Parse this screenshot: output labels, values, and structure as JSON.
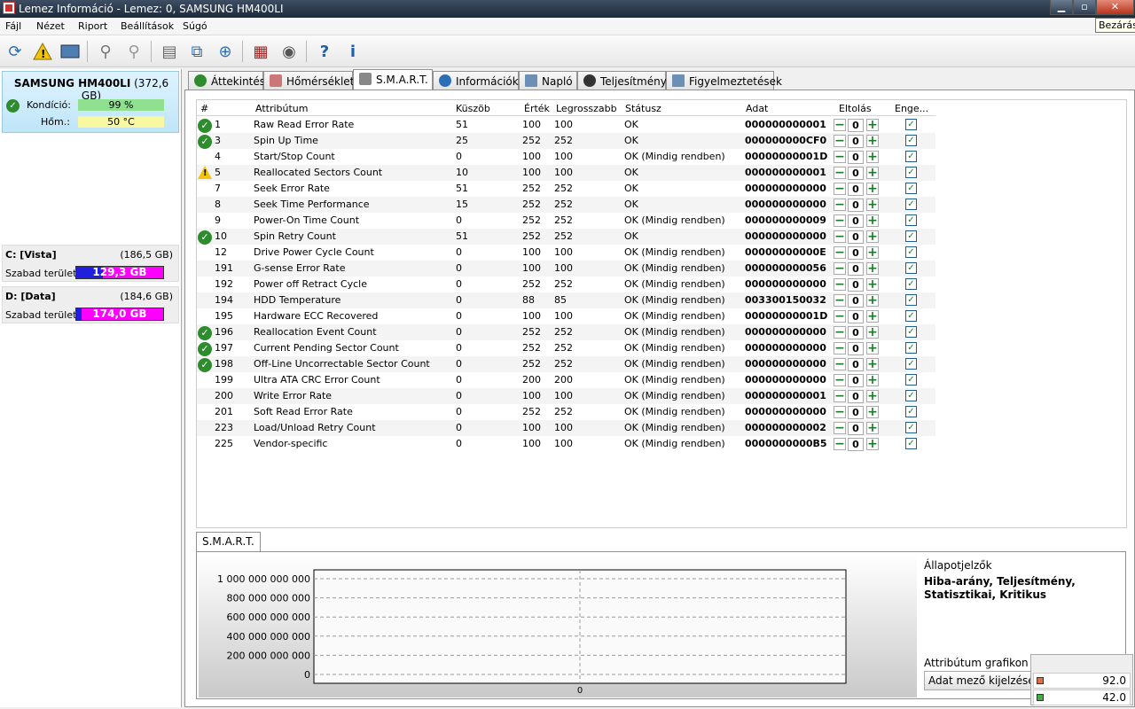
{
  "window": {
    "title": "Lemez Információ - Lemez: 0, SAMSUNG HM400LI",
    "close_tooltip": "Bezárás"
  },
  "menu": [
    "Fájl",
    "Nézet",
    "Riport",
    "Beállítások",
    "Súgó"
  ],
  "toolbar": {
    "icons": [
      "refresh-icon",
      "warning-icon",
      "disk-icon",
      "satellite-icon",
      "satellite-gray-icon",
      "document-icon",
      "copy-icon",
      "network-icon",
      "chart-icon",
      "speaker-icon",
      "help-icon",
      "info-icon"
    ]
  },
  "disk": {
    "name": "SAMSUNG HM400LI",
    "size": "(372,6 GB)",
    "condition_label": "Kondíció:",
    "condition_value": "99 %",
    "temp_label": "Hőm.:",
    "temp_value": "50 °C"
  },
  "partitions": [
    {
      "name": "C: [Vista]",
      "size": "(186,5 GB)",
      "free_label": "Szabad terület",
      "free_value": "129,3 GB",
      "used_fraction": 0.31
    },
    {
      "name": "D: [Data]",
      "size": "(184,6 GB)",
      "free_label": "Szabad terület",
      "free_value": "174,0 GB",
      "used_fraction": 0.06
    }
  ],
  "tabs": [
    "Áttekintés",
    "Hőmérséklet",
    "S.M.A.R.T.",
    "Információk",
    "Napló",
    "Teljesítmény",
    "Figyelmeztetések"
  ],
  "active_tab": "S.M.A.R.T.",
  "table": {
    "headers": [
      "#",
      "Attribútum",
      "Küszöb",
      "Érték",
      "Legrosszabb",
      "Státusz",
      "Adat",
      "Eltolás",
      "Enge..."
    ],
    "rows": [
      {
        "icon": "ok",
        "id": "1",
        "attr": "Raw Read Error Rate",
        "thr": "51",
        "val": "100",
        "worst": "100",
        "status": "OK",
        "data": "000000000001",
        "off": "0"
      },
      {
        "icon": "ok",
        "id": "3",
        "attr": "Spin Up Time",
        "thr": "25",
        "val": "252",
        "worst": "252",
        "status": "OK",
        "data": "000000000CF0",
        "off": "0"
      },
      {
        "icon": "",
        "id": "4",
        "attr": "Start/Stop Count",
        "thr": "0",
        "val": "100",
        "worst": "100",
        "status": "OK (Mindig rendben)",
        "data": "00000000001D",
        "off": "0"
      },
      {
        "icon": "warn",
        "id": "5",
        "attr": "Reallocated Sectors Count",
        "thr": "10",
        "val": "100",
        "worst": "100",
        "status": "OK",
        "data": "000000000001",
        "off": "0"
      },
      {
        "icon": "",
        "id": "7",
        "attr": "Seek Error Rate",
        "thr": "51",
        "val": "252",
        "worst": "252",
        "status": "OK",
        "data": "000000000000",
        "off": "0"
      },
      {
        "icon": "",
        "id": "8",
        "attr": "Seek Time Performance",
        "thr": "15",
        "val": "252",
        "worst": "252",
        "status": "OK",
        "data": "000000000000",
        "off": "0"
      },
      {
        "icon": "",
        "id": "9",
        "attr": "Power-On Time Count",
        "thr": "0",
        "val": "252",
        "worst": "252",
        "status": "OK (Mindig rendben)",
        "data": "000000000009",
        "off": "0"
      },
      {
        "icon": "ok",
        "id": "10",
        "attr": "Spin Retry Count",
        "thr": "51",
        "val": "252",
        "worst": "252",
        "status": "OK",
        "data": "000000000000",
        "off": "0"
      },
      {
        "icon": "",
        "id": "12",
        "attr": "Drive Power Cycle Count",
        "thr": "0",
        "val": "100",
        "worst": "100",
        "status": "OK (Mindig rendben)",
        "data": "00000000000E",
        "off": "0"
      },
      {
        "icon": "",
        "id": "191",
        "attr": "G-sense Error Rate",
        "thr": "0",
        "val": "100",
        "worst": "100",
        "status": "OK (Mindig rendben)",
        "data": "000000000056",
        "off": "0"
      },
      {
        "icon": "",
        "id": "192",
        "attr": "Power off Retract Cycle",
        "thr": "0",
        "val": "252",
        "worst": "252",
        "status": "OK (Mindig rendben)",
        "data": "000000000000",
        "off": "0"
      },
      {
        "icon": "",
        "id": "194",
        "attr": "HDD Temperature",
        "thr": "0",
        "val": "88",
        "worst": "85",
        "status": "OK (Mindig rendben)",
        "data": "003300150032",
        "off": "0"
      },
      {
        "icon": "",
        "id": "195",
        "attr": "Hardware ECC Recovered",
        "thr": "0",
        "val": "100",
        "worst": "100",
        "status": "OK (Mindig rendben)",
        "data": "00000000001D",
        "off": "0"
      },
      {
        "icon": "ok",
        "id": "196",
        "attr": "Reallocation Event Count",
        "thr": "0",
        "val": "252",
        "worst": "252",
        "status": "OK (Mindig rendben)",
        "data": "000000000000",
        "off": "0"
      },
      {
        "icon": "ok",
        "id": "197",
        "attr": "Current Pending Sector Count",
        "thr": "0",
        "val": "252",
        "worst": "252",
        "status": "OK (Mindig rendben)",
        "data": "000000000000",
        "off": "0"
      },
      {
        "icon": "ok",
        "id": "198",
        "attr": "Off-Line Uncorrectable Sector Count",
        "thr": "0",
        "val": "252",
        "worst": "252",
        "status": "OK (Mindig rendben)",
        "data": "000000000000",
        "off": "0"
      },
      {
        "icon": "",
        "id": "199",
        "attr": "Ultra ATA CRC Error Count",
        "thr": "0",
        "val": "200",
        "worst": "200",
        "status": "OK (Mindig rendben)",
        "data": "000000000000",
        "off": "0"
      },
      {
        "icon": "",
        "id": "200",
        "attr": "Write Error Rate",
        "thr": "0",
        "val": "100",
        "worst": "100",
        "status": "OK (Mindig rendben)",
        "data": "000000000001",
        "off": "0"
      },
      {
        "icon": "",
        "id": "201",
        "attr": "Soft Read Error Rate",
        "thr": "0",
        "val": "252",
        "worst": "252",
        "status": "OK (Mindig rendben)",
        "data": "000000000000",
        "off": "0"
      },
      {
        "icon": "",
        "id": "223",
        "attr": "Load/Unload Retry Count",
        "thr": "0",
        "val": "100",
        "worst": "100",
        "status": "OK (Mindig rendben)",
        "data": "000000000002",
        "off": "0"
      },
      {
        "icon": "",
        "id": "225",
        "attr": "Vendor-specific",
        "thr": "0",
        "val": "100",
        "worst": "100",
        "status": "OK (Mindig rendben)",
        "data": "0000000000B5",
        "off": "0"
      }
    ]
  },
  "bottom": {
    "tab": "S.M.A.R.T.",
    "state_title": "Állapotjelzők",
    "state_value": "Hiba-arány, Teljesítmény, Statisztikai, Kritikus",
    "attr_graph_label": "Attribútum grafikon",
    "data_field_button": "Adat mező kijelzése"
  },
  "chart_data": {
    "type": "line",
    "yticks": [
      "1 000 000 000 000",
      "800 000 000 000",
      "600 000 000 000",
      "400 000 000 000",
      "200 000 000 000",
      "0"
    ],
    "ylim": [
      0,
      1000000000000
    ],
    "xticks": [
      "0"
    ],
    "series": []
  },
  "mini_widget": {
    "values": [
      "92.0",
      "42.0"
    ]
  },
  "colors": {
    "ok_green": "#2e8b2e",
    "warn_yellow": "#f1c40f",
    "free_magenta": "#ff00ff",
    "used_blue": "#1f1fdc"
  }
}
